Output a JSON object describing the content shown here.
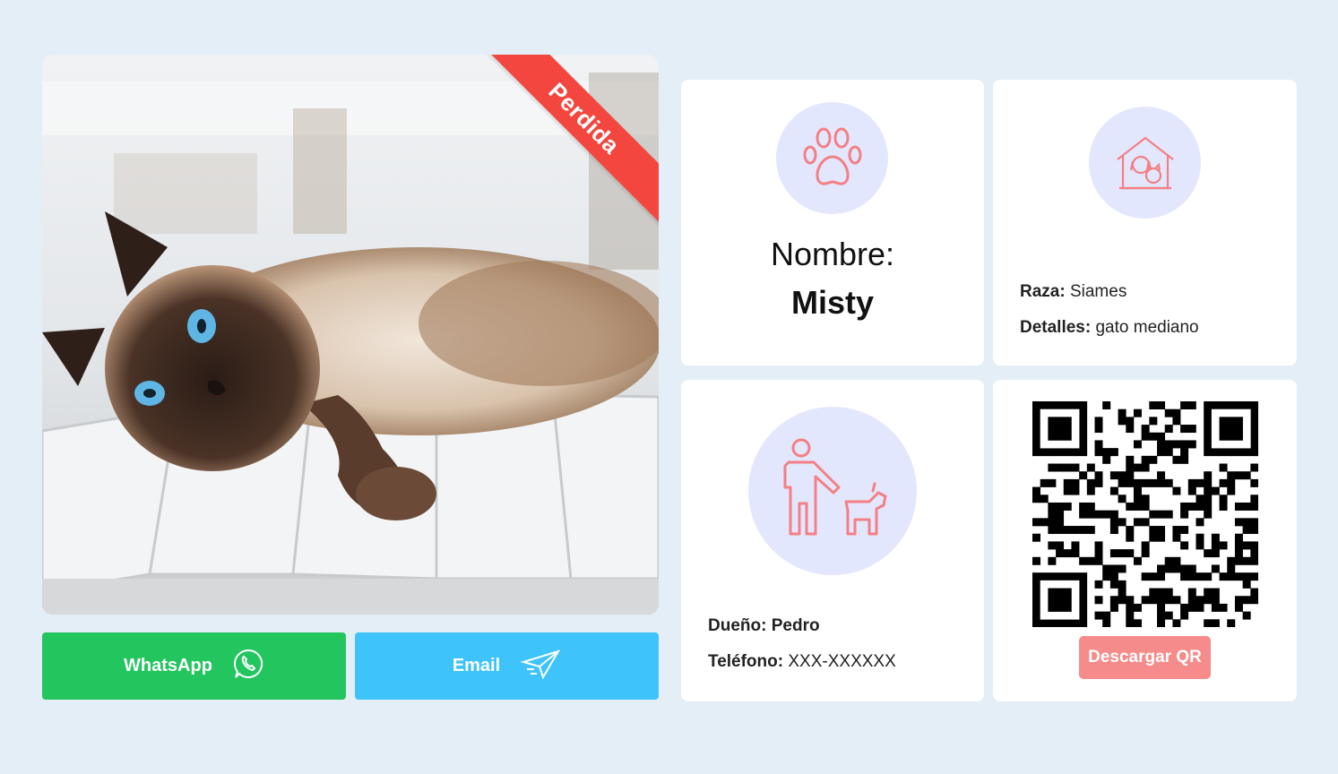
{
  "pet": {
    "status_badge": "Perdida",
    "photo_alt": "Gato siamés acostado"
  },
  "actions": {
    "whatsapp_label": "WhatsApp",
    "email_label": "Email"
  },
  "name_card": {
    "label": "Nombre:",
    "value": "Misty",
    "icon": "paw-icon"
  },
  "breed_card": {
    "icon": "pet-house-icon",
    "breed_label": "Raza:",
    "breed_value": "Siames",
    "details_label": "Detalles:",
    "details_value": "gato mediano"
  },
  "owner_card": {
    "icon": "person-with-dog-icon",
    "owner_label": "Dueño:",
    "owner_value": "Pedro",
    "phone_label": "Teléfono:",
    "phone_value": "XXX-XXXXXX"
  },
  "qr_card": {
    "download_label": "Descargar QR"
  },
  "colors": {
    "page_bg": "#e3eef6",
    "badge": "#f2463e",
    "whatsapp": "#22c55e",
    "email": "#3ec3fb",
    "icon_circle": "#e2e7fd",
    "icon_stroke": "#f47f84",
    "qr_button": "#f58b8a"
  }
}
